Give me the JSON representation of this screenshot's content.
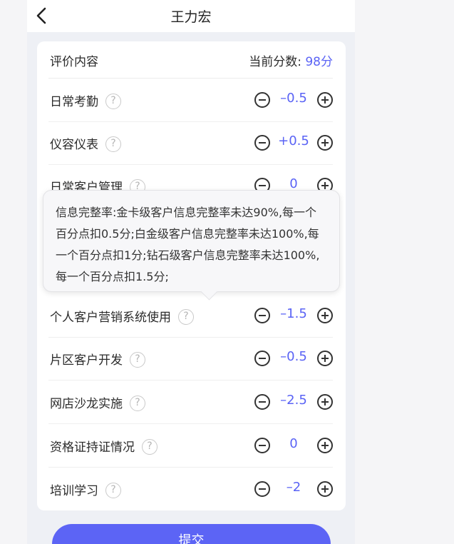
{
  "nav": {
    "title": "王力宏",
    "back_icon": "chevron-left-icon"
  },
  "header": {
    "left_label": "评价内容",
    "score_label": "当前分数:",
    "score_value": "98分"
  },
  "rows": [
    {
      "label": "日常考勤",
      "value": "–0.5"
    },
    {
      "label": "仪容仪表",
      "value": "+0.5"
    },
    {
      "label": "日常客户管理",
      "value": "0"
    },
    {
      "label": "",
      "value": ""
    },
    {
      "label": "个人客户营销系统使用",
      "value": "–1.5"
    },
    {
      "label": "片区客户开发",
      "value": "–0.5"
    },
    {
      "label": "网店沙龙实施",
      "value": "–2.5"
    },
    {
      "label": "资格证持证情况",
      "value": "0"
    },
    {
      "label": "培训学习",
      "value": "–2"
    }
  ],
  "help_glyph": "?",
  "tooltip": {
    "text": "信息完整率:金卡级客户信息完整率未达90%,每一个百分点扣0.5分;白金级客户信息完整率未达100%,每一个百分点扣1分;钻石级客户信息完整率未达100%,每一个百分点扣1.5分;"
  },
  "submit": {
    "label": "提交"
  },
  "colors": {
    "accent": "#5a63f5",
    "button": "#5c64f5",
    "background": "#eef0f5"
  }
}
